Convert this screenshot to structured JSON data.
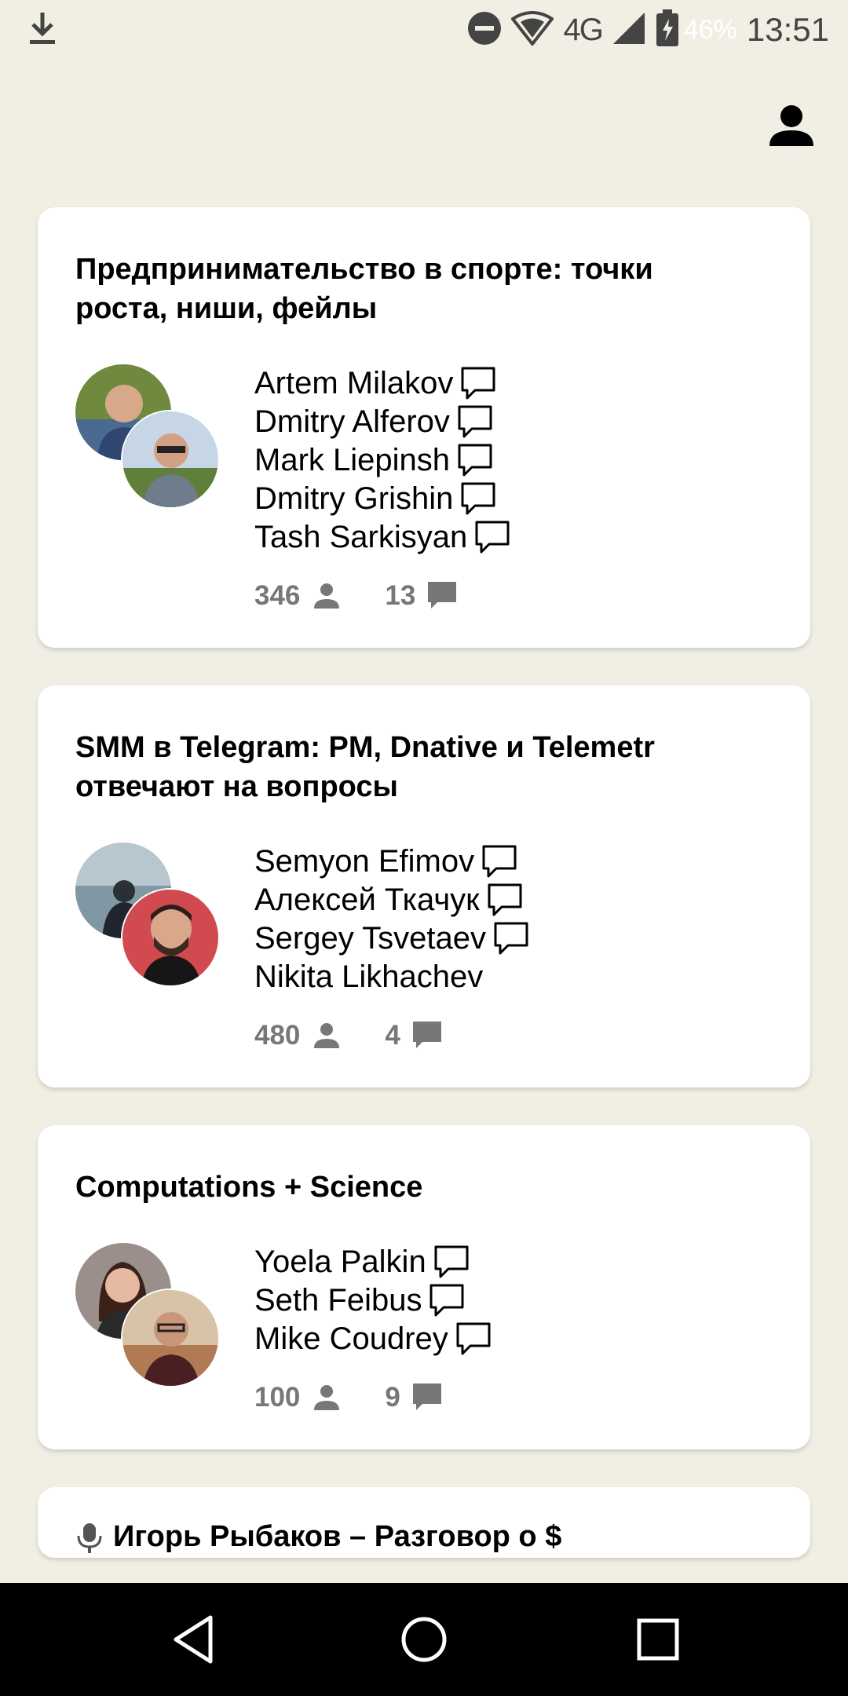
{
  "status_bar": {
    "download_icon": "download-icon",
    "dnd_icon": "do-not-disturb-icon",
    "wifi_icon": "wifi-icon",
    "network": "4G",
    "signal_icon": "signal-icon",
    "battery_icon": "battery-charging-icon",
    "battery": "46%",
    "time": "13:51"
  },
  "header": {
    "profile_icon": "person-icon"
  },
  "rooms": [
    {
      "title": "Предпринимательство в спорте: точки роста, ниши, фейлы",
      "speakers": [
        "Artem Milakov",
        "Dmitry Alferov",
        "Mark Liepinsh",
        "Dmitry Grishin",
        "Tash Sarkisyan"
      ],
      "listeners": "346",
      "chats": "13"
    },
    {
      "title": "SMM в Telegram: PM, Dnative и Telemetr отвечают на вопросы",
      "speakers": [
        "Semyon Efimov",
        "Алексей Ткачук",
        "Sergey Tsvetaev",
        "Nikita Likhachev"
      ],
      "listeners": "480",
      "chats": "4"
    },
    {
      "title": "Computations + Science",
      "speakers": [
        "Yoela Palkin",
        "Seth Feibus",
        "Mike Coudrey"
      ],
      "listeners": "100",
      "chats": "9"
    },
    {
      "title": "Игорь Рыбаков – Разговор о $",
      "icon": "microphone-icon"
    }
  ],
  "nav_bar": {
    "back": "back-icon",
    "home": "home-icon",
    "recents": "recents-icon"
  },
  "colors": {
    "background": "#f1efe4",
    "card": "#ffffff",
    "stat_text": "#777777"
  }
}
